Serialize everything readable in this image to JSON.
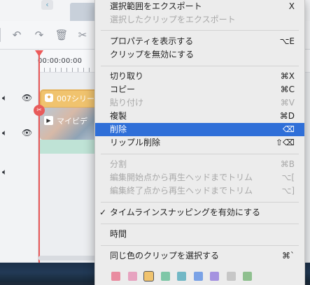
{
  "editor": {
    "timecode": "00:00:00:00",
    "title_clip_label": "007シリー",
    "video_clip_label": "マイビデ",
    "collapse_icon": "‹"
  },
  "context_menu": {
    "items": [
      {
        "label": "選択範囲をエクスポート",
        "shortcut": "X",
        "state": "enabled"
      },
      {
        "label": "選択したクリップをエクスポート",
        "shortcut": "",
        "state": "disabled"
      },
      {
        "label": "プロパティを表示する",
        "shortcut": "⌥E",
        "state": "enabled"
      },
      {
        "label": "クリップを無効にする",
        "shortcut": "",
        "state": "enabled"
      },
      {
        "label": "切り取り",
        "shortcut": "⌘X",
        "state": "enabled"
      },
      {
        "label": "コピー",
        "shortcut": "⌘C",
        "state": "enabled"
      },
      {
        "label": "貼り付け",
        "shortcut": "⌘V",
        "state": "disabled"
      },
      {
        "label": "複製",
        "shortcut": "⌘D",
        "state": "enabled"
      },
      {
        "label": "削除",
        "shortcut": "⌫",
        "state": "highlighted"
      },
      {
        "label": "リップル削除",
        "shortcut": "⇧⌫",
        "state": "enabled"
      },
      {
        "label": "分割",
        "shortcut": "⌘B",
        "state": "disabled"
      },
      {
        "label": "編集開始点から再生ヘッドまでトリム",
        "shortcut": "⌥[",
        "state": "disabled"
      },
      {
        "label": "編集終了点から再生ヘッドまでトリム",
        "shortcut": "⌥]",
        "state": "disabled"
      },
      {
        "label": "タイムラインスナッピングを有効にする",
        "shortcut": "",
        "state": "checked"
      },
      {
        "label": "時間",
        "shortcut": "",
        "state": "enabled"
      },
      {
        "label": "同じ色のクリップを選択する",
        "shortcut": "⌘`",
        "state": "enabled"
      }
    ],
    "check_mark": "✓",
    "color_swatches": [
      "#e98ca0",
      "#e7a3c0",
      "#f0c36e",
      "#7fc7a7",
      "#72b8c6",
      "#7aa2e6",
      "#a592e0",
      "#c7c7c7",
      "#8fc08f"
    ],
    "selected_swatch_index": 2
  }
}
